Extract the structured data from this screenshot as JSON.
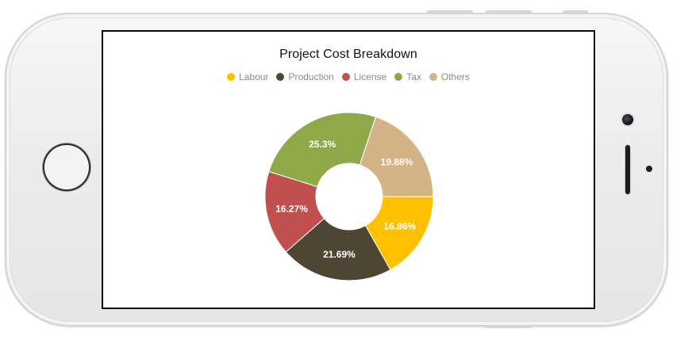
{
  "chart_data": {
    "type": "pie",
    "donut": true,
    "title": "Project Cost Breakdown",
    "legend_position": "top",
    "categories": [
      "Labour",
      "Production",
      "License",
      "Tax",
      "Others"
    ],
    "values": [
      16.86,
      21.69,
      16.27,
      25.3,
      19.88
    ],
    "labels": [
      "16.86%",
      "21.69%",
      "16.27%",
      "25.3%",
      "19.88%"
    ],
    "colors": [
      "#FFC000",
      "#4F4533",
      "#C0504D",
      "#8FA84A",
      "#D4B486"
    ]
  }
}
